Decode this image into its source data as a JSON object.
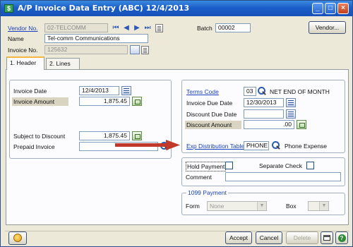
{
  "window": {
    "title": "A/P Invoice Data Entry (ABC) 12/4/2013",
    "app_icon": "app-icon",
    "controls": [
      "minimize-icon",
      "maximize-icon",
      "close-icon"
    ]
  },
  "header": {
    "vendor_label": "Vendor No.",
    "vendor_value": "02-TELCOMM",
    "name_label": "Name",
    "name_value": "Tel-comm Communications",
    "invoice_label": "Invoice No.",
    "invoice_value": "125632",
    "batch_label": "Batch",
    "batch_value": "00002",
    "vendor_button": "Vendor..."
  },
  "tabs": [
    "1. Header",
    "2. Lines"
  ],
  "left": {
    "invoice_date_label": "Invoice Date",
    "invoice_date_value": "12/4/2013",
    "invoice_amount_label": "Invoice Amount",
    "invoice_amount_value": "1,875.45",
    "subject_label": "Subject to Discount",
    "subject_value": "1,875.45",
    "prepaid_label": "Prepaid Invoice",
    "prepaid_value": ""
  },
  "right": {
    "terms_label": "Terms Code",
    "terms_code": "03",
    "terms_desc": "NET END OF MONTH",
    "due_label": "Invoice Due Date",
    "due_value": "12/30/2013",
    "disc_due_label": "Discount Due Date",
    "disc_due_value": "",
    "disc_amt_label": "Discount Amount",
    "disc_amt_value": ".00",
    "exp_label": "Exp Distribution Table",
    "exp_value": "PHONE",
    "exp_desc": "Phone Expense"
  },
  "options": {
    "hold_label": "Hold Payment",
    "separate_label": "Separate Check",
    "comment_label": "Comment",
    "comment_value": "",
    "payment_caption": "1099 Payment",
    "form_label": "Form",
    "form_value": "None",
    "box_label": "Box",
    "box_value": ""
  },
  "footer": {
    "accept": "Accept",
    "cancel": "Cancel",
    "delete": "Delete"
  },
  "colors": {
    "accent": "#1b5fc9",
    "arrow": "#c0392b",
    "link": "#1a3fbd"
  }
}
